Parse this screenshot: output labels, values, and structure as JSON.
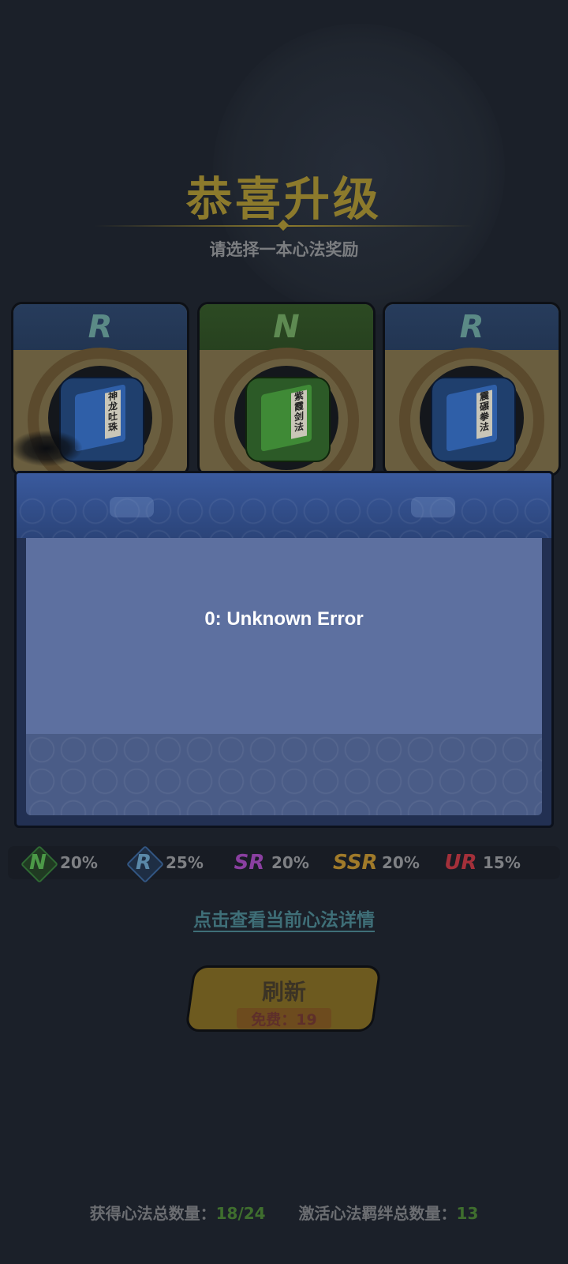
{
  "header": {
    "title": "恭喜升级",
    "subtitle": "请选择一本心法奖励"
  },
  "cards": [
    {
      "rarity": "R",
      "book_title": "神龙吐珠",
      "color": "#2f5fa8"
    },
    {
      "rarity": "N",
      "book_title": "紫霞剑法",
      "color": "#3f8a36"
    },
    {
      "rarity": "R",
      "book_title": "震碾拳法",
      "color": "#2f5fa8"
    }
  ],
  "dialog": {
    "message": "0: Unknown Error"
  },
  "rates": [
    {
      "tier": "N",
      "percent": "20%",
      "color": "#4c9a48"
    },
    {
      "tier": "R",
      "percent": "25%",
      "color": "#5a88a8"
    },
    {
      "tier": "SR",
      "percent": "20%",
      "color": "#8a3fa0"
    },
    {
      "tier": "SSR",
      "percent": "20%",
      "color": "#a07a2a"
    },
    {
      "tier": "UR",
      "percent": "15%",
      "color": "#a3303a"
    }
  ],
  "detail_link": "点击查看当前心法详情",
  "refresh_button": {
    "label": "刷新",
    "sub": "免费：19"
  },
  "footer": {
    "total_label": "获得心法总数量：",
    "total_value": "18/24",
    "bond_label": "激活心法羁绊总数量：",
    "bond_value": "13"
  }
}
